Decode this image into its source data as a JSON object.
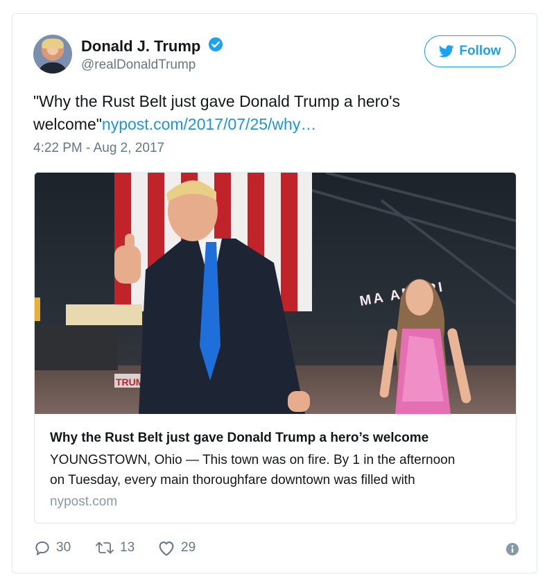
{
  "user": {
    "display_name": "Donald J. Trump",
    "handle": "@realDonaldTrump",
    "verified": true
  },
  "follow_label": "Follow",
  "tweet": {
    "text": "\"Why the Rust Belt just gave Donald Trump a hero's welcome\"",
    "link": "nypost.com/2017/07/25/why…",
    "timestamp": "4:22 PM - Aug 2, 2017"
  },
  "card": {
    "image_text": "MA AMERI",
    "sign_text": "TRUMP",
    "title": "Why the Rust Belt just gave Donald Trump a hero’s welcome",
    "description_line1": "YOUNGSTOWN, Ohio — This town was on fire. By 1 in the afternoon",
    "description_line2": "on Tuesday, every main thoroughfare downtown was filled with",
    "domain": "nypost.com"
  },
  "actions": {
    "replies": "30",
    "retweets": "13",
    "likes": "29"
  },
  "colors": {
    "accent": "#1da1f2",
    "link": "#1b95e0",
    "muted": "#657786"
  }
}
